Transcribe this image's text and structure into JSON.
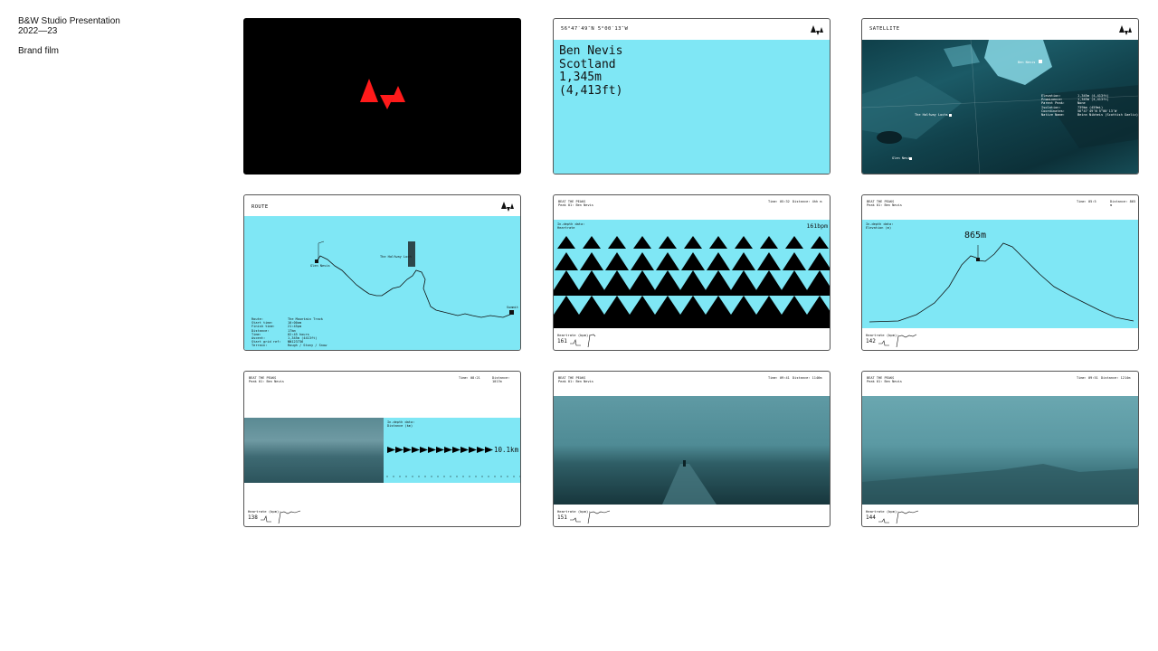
{
  "sidebar": {
    "title": "B&W Studio Presentation",
    "years": "2022—23",
    "section": "Brand film"
  },
  "colors": {
    "cyan": "#7fe7f5",
    "logo_red": "#ff1a1a",
    "black": "#000000"
  },
  "cards": {
    "intro": {
      "logo": "peaks-logo-icon"
    },
    "location": {
      "coords": "56°47′49″N 5°00′13″W",
      "lines": [
        "Ben Nevis",
        "Scotland",
        "1,345m",
        "(4,413ft)"
      ]
    },
    "satellite": {
      "label": "SATELLITE",
      "places": [
        "Ben Nevis",
        "The Halfway Lochs",
        "Glen Nevis"
      ],
      "facts": [
        [
          "Elevation:",
          "1,345m (4,413ft)"
        ],
        [
          "Prominence:",
          "1,345m (4,413ft)"
        ],
        [
          "Parent Peak:",
          "None"
        ],
        [
          "Isolation:",
          "739km (459mi)"
        ],
        [
          "Coordinates:",
          "56°47′49″N 5°00′13″W"
        ],
        [
          "Native Name:",
          "Beinn Nibheis (Scottish Gaelic)"
        ]
      ]
    },
    "route": {
      "label": "ROUTE",
      "start": "Glen Nevis",
      "lochan": "The Halfway Loch",
      "summit": "Summit",
      "details": [
        [
          "Route:",
          "The Mountain Track"
        ],
        [
          "Start time:",
          "10:00am"
        ],
        [
          "Finish time:",
          "21:45pm"
        ],
        [
          "Distance:",
          "17km"
        ],
        [
          "Time:",
          "02:45 hours"
        ],
        [
          "Ascent:",
          "1,345m (4413ft)"
        ],
        [
          "Start grid ref:",
          "NN123736"
        ],
        [
          "Terrain:",
          "Rough / Stony / Snow"
        ]
      ]
    },
    "heartrate": {
      "brand": "BEAT THE PEAKS",
      "sub": "Peak 01: Ben Nevis",
      "time": "Time: 05:32",
      "dist": "Distance: 4hh m",
      "data_title": "In-depth data:",
      "data_kind": "Heartrate",
      "value": "161bpm",
      "hr_label": "Heartrate (bpm):",
      "hr": "161"
    },
    "elevation": {
      "brand": "BEAT THE PEAKS",
      "sub": "Peak 01: Ben Nevis",
      "time": "Time: 05:5",
      "dist": "Distance: 865 m",
      "data_title": "In-depth data:",
      "data_kind": "Elevation (m)",
      "value": "865m",
      "hr_label": "Heartrate (bpm):",
      "hr": "142"
    },
    "distance": {
      "brand": "BEAT THE PEAKS",
      "sub": "Peak 01: Ben Nevis",
      "time": "Time: 08:21",
      "dist": "Distance: 1017m",
      "data_title": "In-depth data:",
      "data_kind": "Distance (km)",
      "value": "10.1km",
      "hr_label": "Heartrate (bpm):",
      "hr": "138"
    },
    "fog1": {
      "brand": "BEAT THE PEAKS",
      "sub": "Peak 01: Ben Nevis",
      "time": "Time: 09:41",
      "dist": "Distance: 1146m",
      "hr_label": "Heartrate (bpm):",
      "hr": "151"
    },
    "fog2": {
      "brand": "BEAT THE PEAKS",
      "sub": "Peak 01: Ben Nevis",
      "time": "Time: 09:51",
      "dist": "Distance: 1214m",
      "hr_label": "Heartrate (bpm):",
      "hr": "144"
    }
  }
}
